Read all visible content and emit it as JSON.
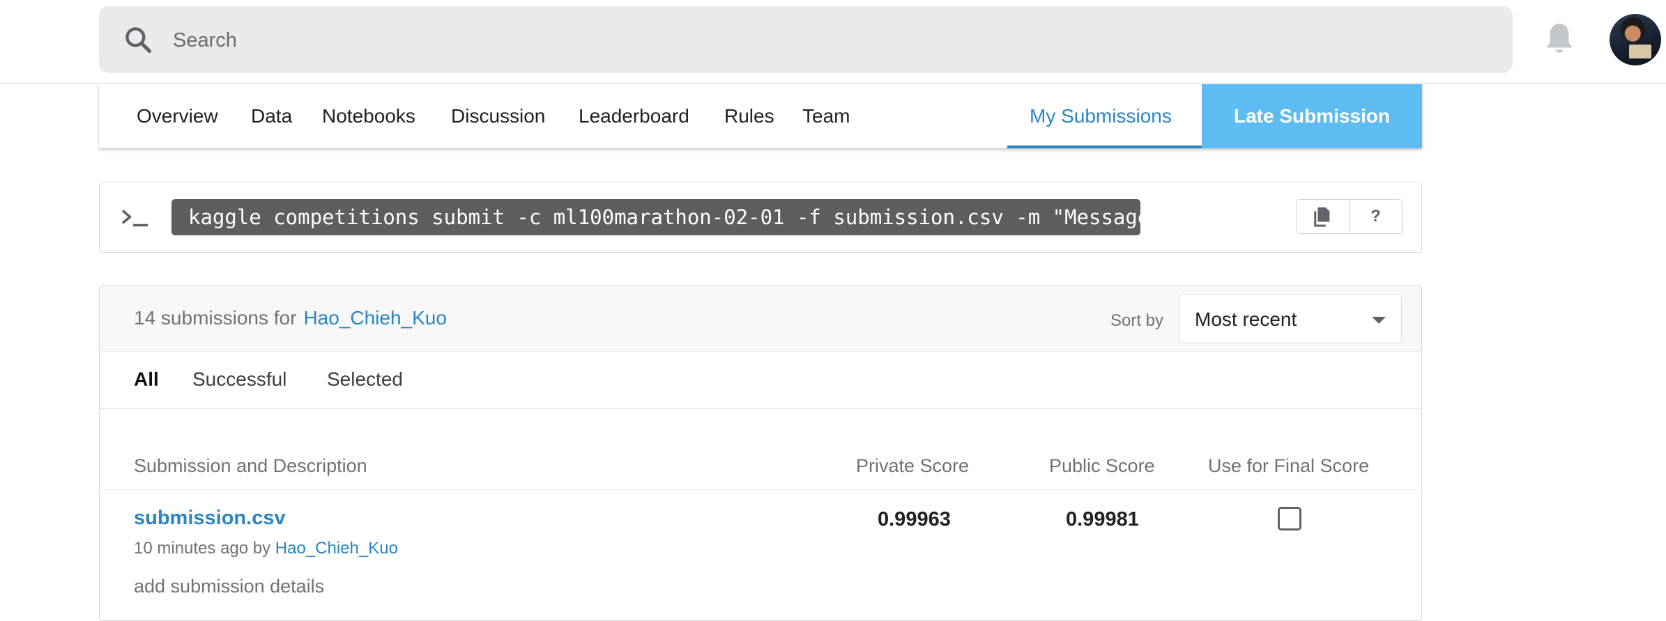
{
  "search": {
    "placeholder": "Search",
    "value": ""
  },
  "header": {
    "icons": [
      "search-icon",
      "bell-icon",
      "avatar"
    ]
  },
  "tabs": [
    {
      "label": "Overview"
    },
    {
      "label": "Data"
    },
    {
      "label": "Notebooks"
    },
    {
      "label": "Discussion"
    },
    {
      "label": "Leaderboard"
    },
    {
      "label": "Rules"
    },
    {
      "label": "Team"
    },
    {
      "label": "My Submissions",
      "active": true
    }
  ],
  "late_submission_label": "Late Submission",
  "command": {
    "text": "kaggle competitions submit -c ml100marathon-02-01 -f submission.csv -m \"Message\"",
    "help_label": "?"
  },
  "submissions": {
    "count_text": "14 submissions for",
    "user": "Hao_Chieh_Kuo",
    "sort_label": "Sort by",
    "sort_value": "Most recent",
    "filters": [
      "All",
      "Successful",
      "Selected"
    ],
    "active_filter": "All",
    "columns": {
      "description": "Submission and Description",
      "private": "Private Score",
      "public": "Public Score",
      "final": "Use for Final Score"
    },
    "rows": [
      {
        "filename": "submission.csv",
        "time": "10 minutes ago by",
        "user": "Hao_Chieh_Kuo",
        "details_link": "add submission details",
        "private_score": "0.99963",
        "public_score": "0.99981",
        "use_for_final": false
      }
    ]
  },
  "colors": {
    "accent": "#2a85c4",
    "late_button": "#5dbdf3",
    "command_bg": "#5d5e60"
  }
}
